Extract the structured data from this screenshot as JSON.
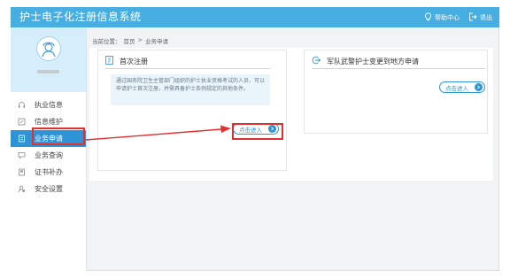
{
  "header": {
    "title": "护士电子化注册信息系统",
    "help_label": "帮助中心",
    "logout_label": "退出",
    "bg_color": "#47aee2"
  },
  "sidebar": {
    "items": [
      {
        "label": "执业信息",
        "icon": "headset-icon",
        "active": false
      },
      {
        "label": "信息维护",
        "icon": "edit-icon",
        "active": false
      },
      {
        "label": "业务申请",
        "icon": "document-icon",
        "active": true
      },
      {
        "label": "业务查询",
        "icon": "chat-icon",
        "active": false
      },
      {
        "label": "证书补办",
        "icon": "certificate-icon",
        "active": false
      },
      {
        "label": "安全设置",
        "icon": "user-lock-icon",
        "active": false
      }
    ],
    "active_color": "#2f93d8"
  },
  "breadcrumb": {
    "prefix": "当前位置：",
    "home": "首页",
    "separator": ">",
    "current": "业务申请"
  },
  "cards": [
    {
      "title": "首次注册",
      "icon": "document-icon",
      "description": "通过国务院卫生主管部门组织的护士执业资格考试的人员，可以申请护士首次注册，并需具备护士条例规定的其他条件。",
      "button_label": "点击进入"
    },
    {
      "title": "军队武警护士变更到地方申请",
      "icon": "exit-arrow-icon",
      "button_label": "点击进入"
    }
  ],
  "annotation": {
    "highlight_color": "#e03030"
  }
}
